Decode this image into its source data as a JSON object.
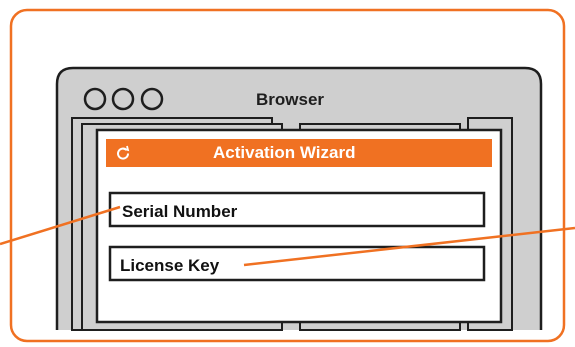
{
  "browser": {
    "title": "Browser",
    "window_buttons": [
      "circle-button",
      "circle-button",
      "circle-button"
    ]
  },
  "wizard": {
    "title": "Activation Wizard",
    "refresh_icon": "refresh-icon",
    "fields": [
      {
        "label": "Serial Number"
      },
      {
        "label": "License Key"
      }
    ]
  },
  "colors": {
    "accent": "#f07122",
    "frame_gray": "#cfcfcf",
    "stroke": "#1e1e1e",
    "background": "#ffffff"
  }
}
